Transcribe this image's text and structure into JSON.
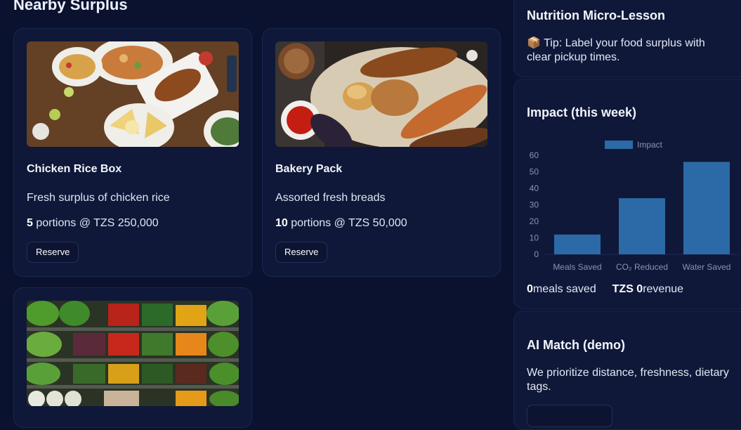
{
  "section": {
    "title": "Nearby Surplus"
  },
  "listings": [
    {
      "name": "Chicken Rice Box",
      "description": "Fresh surplus of chicken rice",
      "qty": "5",
      "qty_suffix": " portions @ TZS 250,000",
      "button": "Reserve"
    },
    {
      "name": "Bakery Pack",
      "description": "Assorted fresh breads",
      "qty": "10",
      "qty_suffix": " portions @ TZS 50,000",
      "button": "Reserve"
    }
  ],
  "lesson": {
    "title": "Nutrition Micro-Lesson",
    "icon": "📦",
    "tip": "Tip: Label your food surplus with clear pickup times."
  },
  "impact": {
    "title": "Impact (this week)",
    "meals_value": "0",
    "meals_label": "meals saved",
    "revenue_value": "TZS 0",
    "revenue_label": "revenue"
  },
  "chart_data": {
    "type": "bar",
    "categories": [
      "Meals Saved",
      "CO₂ Reduced",
      "Water Saved"
    ],
    "series": [
      {
        "name": "Impact",
        "values": [
          12,
          34,
          56
        ]
      }
    ],
    "ylim": [
      0,
      60
    ],
    "yticks": [
      0,
      10,
      20,
      30,
      40,
      50,
      60
    ],
    "legend": "top",
    "color": "#2b6aa6"
  },
  "ai": {
    "title": "AI Match (demo)",
    "text": "We prioritize distance, freshness, dietary tags."
  }
}
